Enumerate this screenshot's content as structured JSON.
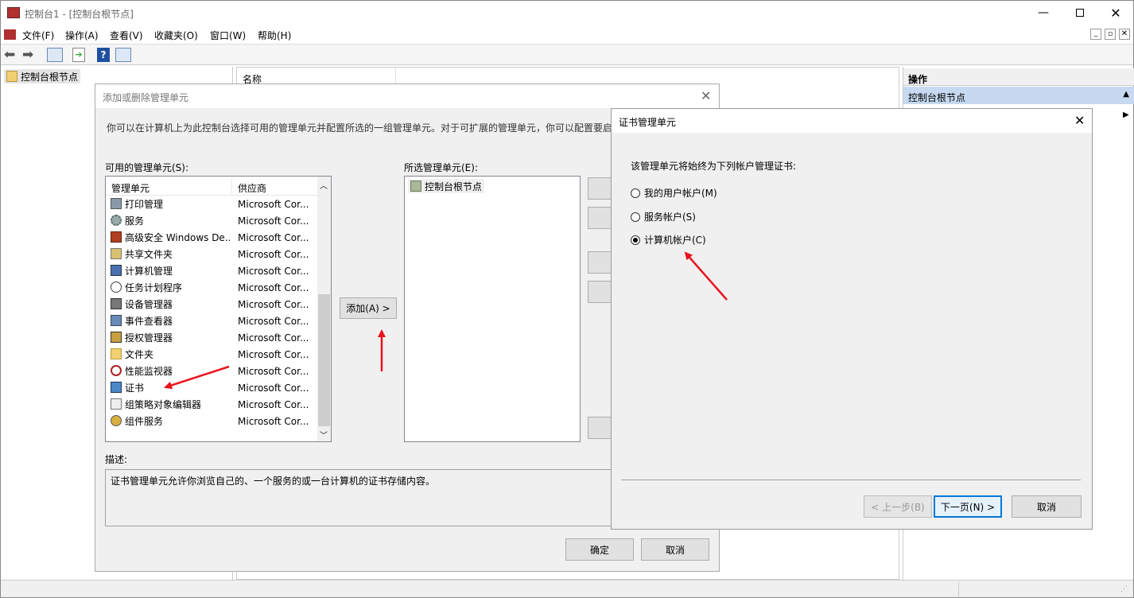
{
  "window": {
    "title": "控制台1 - [控制台根节点]"
  },
  "menubar": {
    "items": [
      "文件(F)",
      "操作(A)",
      "查看(V)",
      "收藏夹(O)",
      "窗口(W)",
      "帮助(H)"
    ]
  },
  "tree": {
    "root": "控制台根节点"
  },
  "center": {
    "column_name": "名称"
  },
  "actions": {
    "header": "操作",
    "item": "控制台根节点"
  },
  "addremove": {
    "title": "添加或删除管理单元",
    "description": "你可以在计算机上为此控制台选择可用的管理单元并配置所选的一组管理单元。对于可扩展的管理单元，你可以配置要启",
    "available_label": "可用的管理单元(S):",
    "col_snapin": "管理单元",
    "col_vendor": "供应商",
    "snapins": [
      {
        "name": "打印管理",
        "vendor": "Microsoft Cor..."
      },
      {
        "name": "服务",
        "vendor": "Microsoft Cor..."
      },
      {
        "name": "高级安全 Windows De...",
        "vendor": "Microsoft Cor..."
      },
      {
        "name": "共享文件夹",
        "vendor": "Microsoft Cor..."
      },
      {
        "name": "计算机管理",
        "vendor": "Microsoft Cor..."
      },
      {
        "name": "任务计划程序",
        "vendor": "Microsoft Cor..."
      },
      {
        "name": "设备管理器",
        "vendor": "Microsoft Cor..."
      },
      {
        "name": "事件查看器",
        "vendor": "Microsoft Cor..."
      },
      {
        "name": "授权管理器",
        "vendor": "Microsoft Cor..."
      },
      {
        "name": "文件夹",
        "vendor": "Microsoft Cor..."
      },
      {
        "name": "性能监视器",
        "vendor": "Microsoft Cor..."
      },
      {
        "name": "证书",
        "vendor": "Microsoft Cor..."
      },
      {
        "name": "组策略对象编辑器",
        "vendor": "Microsoft Cor..."
      },
      {
        "name": "组件服务",
        "vendor": "Microsoft Cor..."
      }
    ],
    "add_button": "添加(A) >",
    "selected_label": "所选管理单元(E):",
    "selected_items": [
      "控制台根节点"
    ],
    "desc_label": "描述:",
    "desc_text": "证书管理单元允许你浏览自己的、一个服务的或一台计算机的证书存储内容。",
    "ok": "确定",
    "cancel": "取消"
  },
  "certdialog": {
    "title": "证书管理单元",
    "prompt": "该管理单元将始终为下列帐户管理证书:",
    "options": [
      "我的用户帐户(M)",
      "服务帐户(S)",
      "计算机帐户(C)"
    ],
    "selected_index": 2,
    "back": "< 上一步(B)",
    "next": "下一页(N) >",
    "cancel": "取消"
  },
  "colors": {
    "accent_arrow": "#e8141e",
    "selection": "#cce8ff",
    "actions_header": "#c6d9f0"
  }
}
